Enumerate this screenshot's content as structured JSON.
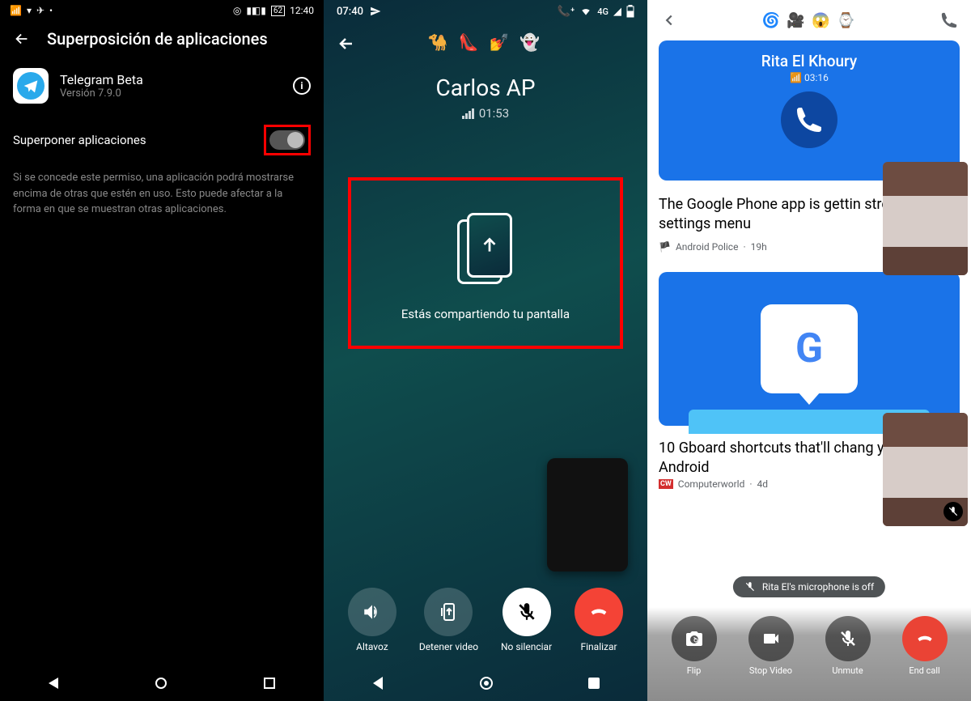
{
  "screen1": {
    "status": {
      "time": "12:40",
      "battery": "62"
    },
    "title": "Superposición de aplicaciones",
    "app": {
      "name": "Telegram Beta",
      "version": "Versión 7.9.0"
    },
    "toggle_label": "Superponer aplicaciones",
    "description": "Si se concede este permiso, una aplicación podrá mostrarse encima de otras que estén en uso. Esto puede afectar a la forma en que se muestran otras aplicaciones."
  },
  "screen2": {
    "status": {
      "time": "07:40",
      "network": "4G"
    },
    "emojis": "🐪 👠 💅 👻",
    "caller": "Carlos AP",
    "duration": "01:53",
    "sharing_text": "Estás compartiendo tu pantalla",
    "buttons": {
      "speaker": "Altavoz",
      "stop_video": "Detener video",
      "unmute": "No silenciar",
      "end": "Finalizar"
    }
  },
  "screen3": {
    "emojis": "🌀 🎥 😱 ⌚",
    "caller": "Rita El Khoury",
    "duration": "03:16",
    "article1": {
      "title": "The Google Phone app is gettin streamlined settings menu",
      "source": "Android Police",
      "age": "19h"
    },
    "article2": {
      "title": "10 Gboard shortcuts that'll chang you type on Android",
      "source": "Computerworld",
      "age": "4d"
    },
    "mic_notice": "Rita El's microphone is off",
    "buttons": {
      "flip": "Flip",
      "stop_video": "Stop Video",
      "unmute": "Unmute",
      "end": "End call"
    }
  }
}
